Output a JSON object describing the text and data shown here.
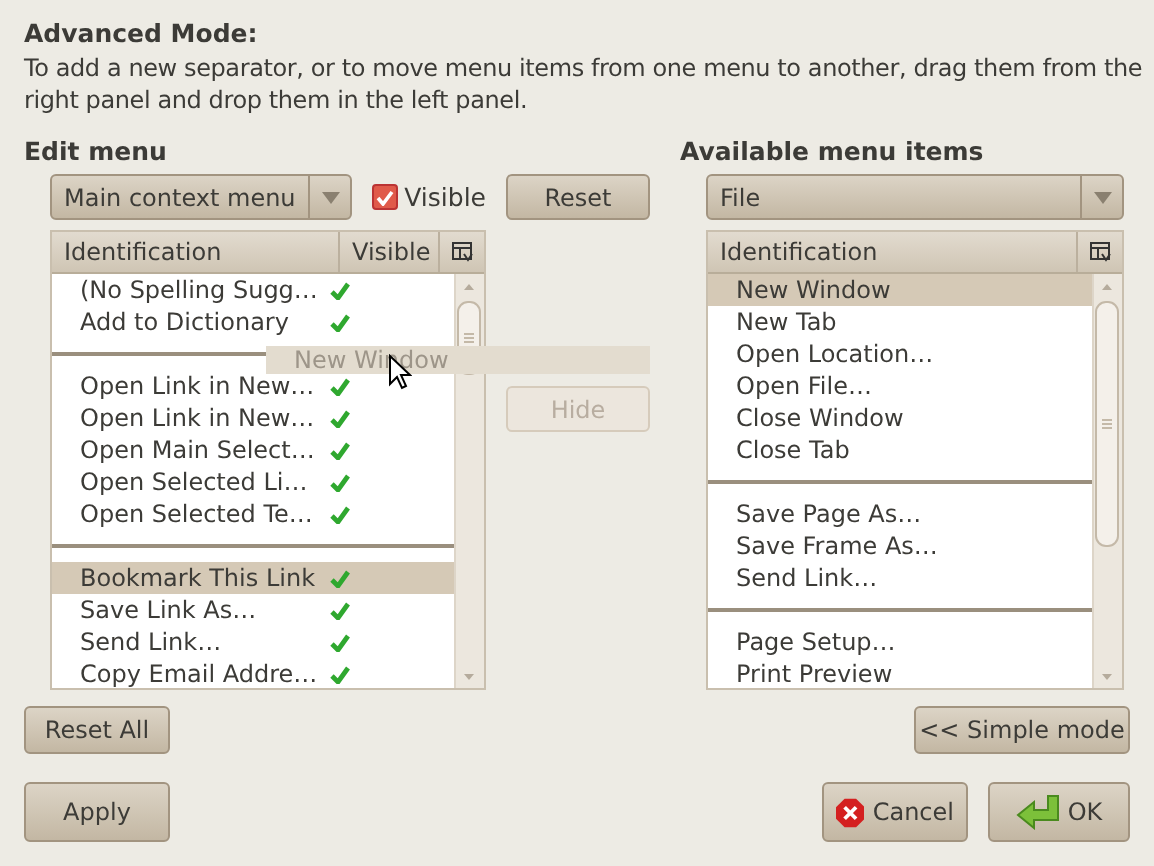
{
  "heading": "Advanced Mode:",
  "description": "To add a new separator, or to move menu items from one menu to another, drag them from the right panel and drop them in the left panel.",
  "edit_menu": {
    "title": "Edit menu",
    "select": {
      "value": "Main context menu"
    },
    "visible_checkbox": {
      "label": "Visible",
      "checked": true
    },
    "reset_button": "Reset",
    "columns": [
      "Identification",
      "Visible"
    ],
    "items": [
      {
        "kind": "item",
        "label": "(No Spelling Sugg…",
        "visible": true,
        "selected": false
      },
      {
        "kind": "item",
        "label": "Add to Dictionary",
        "visible": true,
        "selected": false
      },
      {
        "kind": "separator"
      },
      {
        "kind": "item",
        "label": "Open Link in New…",
        "visible": true,
        "selected": false
      },
      {
        "kind": "item",
        "label": "Open Link in New…",
        "visible": true,
        "selected": false
      },
      {
        "kind": "item",
        "label": "Open Main Select…",
        "visible": true,
        "selected": false
      },
      {
        "kind": "item",
        "label": "Open Selected Li…",
        "visible": true,
        "selected": false
      },
      {
        "kind": "item",
        "label": "Open Selected Te…",
        "visible": true,
        "selected": false
      },
      {
        "kind": "separator"
      },
      {
        "kind": "item",
        "label": "Bookmark This Link",
        "visible": true,
        "selected": true
      },
      {
        "kind": "item",
        "label": "Save Link As…",
        "visible": true,
        "selected": false
      },
      {
        "kind": "item",
        "label": "Send Link…",
        "visible": true,
        "selected": false
      },
      {
        "kind": "item",
        "label": "Copy Email Addre…",
        "visible": true,
        "selected": false
      }
    ]
  },
  "hide_button": {
    "label": "Hide",
    "disabled": true
  },
  "drag_item": "New Window",
  "available": {
    "title": "Available menu items",
    "select": {
      "value": "File"
    },
    "columns": [
      "Identification"
    ],
    "items": [
      {
        "kind": "item",
        "label": "New Window",
        "selected": true
      },
      {
        "kind": "item",
        "label": "New Tab",
        "selected": false
      },
      {
        "kind": "item",
        "label": "Open Location…",
        "selected": false
      },
      {
        "kind": "item",
        "label": "Open File…",
        "selected": false
      },
      {
        "kind": "item",
        "label": "Close Window",
        "selected": false
      },
      {
        "kind": "item",
        "label": "Close Tab",
        "selected": false
      },
      {
        "kind": "separator"
      },
      {
        "kind": "item",
        "label": "Save Page As…",
        "selected": false
      },
      {
        "kind": "item",
        "label": "Save Frame As…",
        "selected": false
      },
      {
        "kind": "item",
        "label": "Send Link…",
        "selected": false
      },
      {
        "kind": "separator"
      },
      {
        "kind": "item",
        "label": "Page Setup…",
        "selected": false
      },
      {
        "kind": "item",
        "label": "Print Preview",
        "selected": false
      }
    ]
  },
  "buttons": {
    "reset_all": "Reset All",
    "simple_mode": "<< Simple mode",
    "apply": "Apply",
    "cancel": "Cancel",
    "ok": "OK"
  }
}
